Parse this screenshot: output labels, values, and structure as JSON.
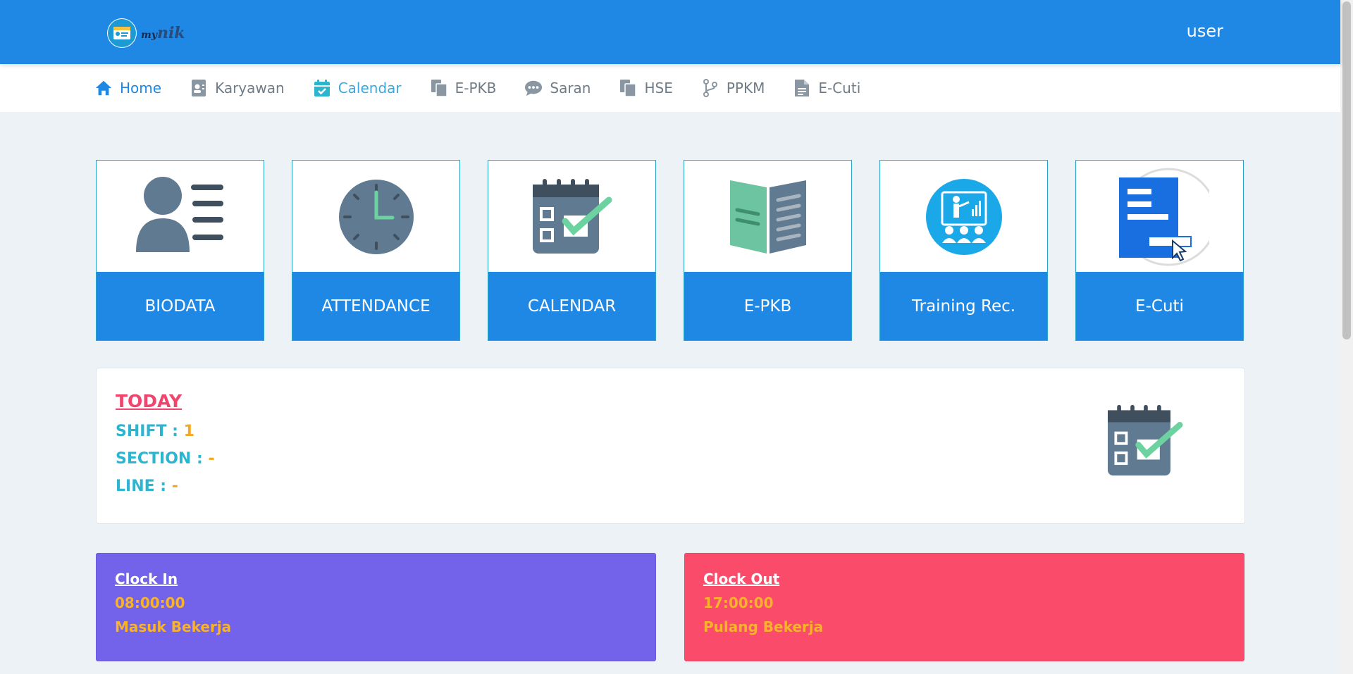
{
  "header": {
    "logo_small": "my",
    "logo_big": "nik",
    "user": "user"
  },
  "nav": [
    {
      "label": "Home",
      "icon": "home-icon"
    },
    {
      "label": "Karyawan",
      "icon": "id-card-icon"
    },
    {
      "label": "Calendar",
      "icon": "calendar-check-icon"
    },
    {
      "label": "E-PKB",
      "icon": "copy-icon"
    },
    {
      "label": "Saran",
      "icon": "chat-icon"
    },
    {
      "label": "HSE",
      "icon": "copy-icon"
    },
    {
      "label": "PPKM",
      "icon": "branch-icon"
    },
    {
      "label": "E-Cuti",
      "icon": "document-icon"
    }
  ],
  "tiles": [
    {
      "label": "BIODATA",
      "icon": "biodata-icon"
    },
    {
      "label": "ATTENDANCE",
      "icon": "clock-icon"
    },
    {
      "label": "CALENDAR",
      "icon": "calendar-icon"
    },
    {
      "label": "E-PKB",
      "icon": "book-icon"
    },
    {
      "label": "Training Rec.",
      "icon": "training-icon"
    },
    {
      "label": "E-Cuti",
      "icon": "form-icon"
    }
  ],
  "today": {
    "title": "TODAY",
    "shift_label": "SHIFT : ",
    "shift_value": "1",
    "section_label": "SECTION : ",
    "section_value": "-",
    "line_label": "LINE : ",
    "line_value": "-"
  },
  "clock_in": {
    "title": "Clock In",
    "time": "08:00:00",
    "note": "Masuk Bekerja"
  },
  "clock_out": {
    "title": "Clock Out",
    "time": "17:00:00",
    "note": "Pulang Bekerja"
  },
  "colors": {
    "primary": "#1f88e5",
    "clock_in_bg": "#7362ea",
    "clock_out_bg": "#fa4b6b",
    "accent_orange": "#f6a623",
    "accent_cyan": "#2bb5d1",
    "accent_pink": "#f0466e"
  }
}
